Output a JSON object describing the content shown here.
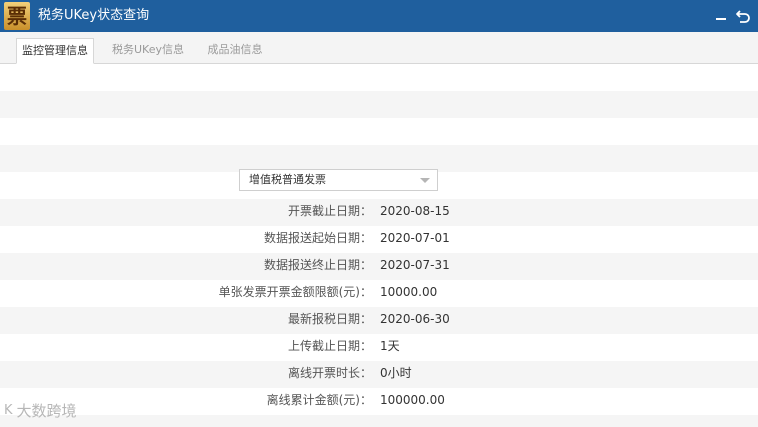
{
  "window": {
    "title": "税务UKey状态查询",
    "icon_char": "票"
  },
  "tabs": [
    {
      "label": "监控管理信息",
      "active": true
    },
    {
      "label": "税务UKey信息",
      "active": false
    },
    {
      "label": "成品油信息",
      "active": false
    }
  ],
  "invoice_type_select": {
    "selected": "增值税普通发票"
  },
  "fields": [
    {
      "label": "开票截止日期：",
      "value": "2020-08-15"
    },
    {
      "label": "数据报送起始日期：",
      "value": "2020-07-01"
    },
    {
      "label": "数据报送终止日期：",
      "value": "2020-07-31"
    },
    {
      "label": "单张发票开票金额限额(元)：",
      "value": "10000.00"
    },
    {
      "label": "最新报税日期：",
      "value": "2020-06-30"
    },
    {
      "label": "上传截止日期：",
      "value": "1天"
    },
    {
      "label": "离线开票时长：",
      "value": "0小时"
    },
    {
      "label": "离线累计金额(元)：",
      "value": "100000.00"
    }
  ],
  "watermark": {
    "logo": "K",
    "text": "大数跨境"
  },
  "colors": {
    "titlebar": "#1f5f9e",
    "stripe": "#f5f5f5"
  }
}
